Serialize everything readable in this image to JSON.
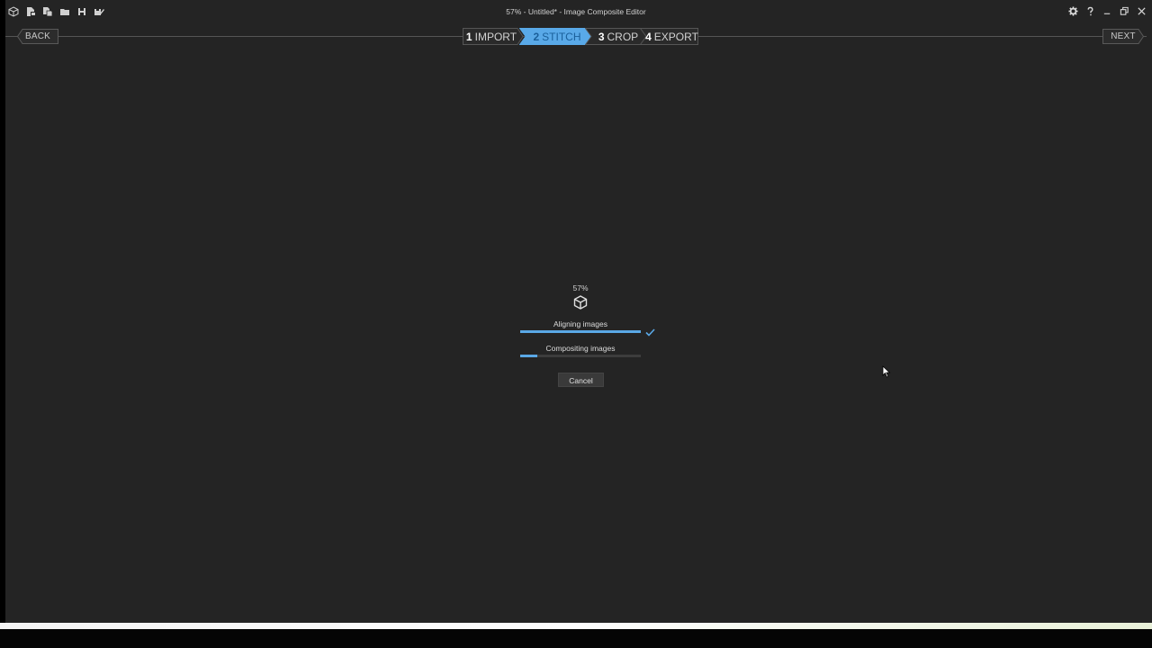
{
  "window": {
    "title": "57% - Untitled* - Image Composite Editor"
  },
  "quick_access_icons": [
    "app-cube-icon",
    "new-panorama-icon",
    "new-multi-icon",
    "open-folder-icon",
    "save-icon",
    "save-as-icon"
  ],
  "window_controls": [
    "settings-gear-icon",
    "help-icon",
    "minimize-icon",
    "restore-icon",
    "close-icon"
  ],
  "nav": {
    "back_label": "BACK",
    "next_label": "NEXT",
    "steps": [
      {
        "num": "1",
        "label": "IMPORT",
        "active": false
      },
      {
        "num": "2",
        "label": "STITCH",
        "active": true
      },
      {
        "num": "3",
        "label": "CROP",
        "active": false
      },
      {
        "num": "4",
        "label": "EXPORT",
        "active": false
      }
    ]
  },
  "progress": {
    "percent_text": "57%",
    "tasks": [
      {
        "label": "Aligning images",
        "progress": 1.0,
        "done": true
      },
      {
        "label": "Compositing images",
        "progress": 0.14,
        "done": false
      }
    ],
    "cancel_label": "Cancel"
  },
  "colors": {
    "background": "#242424",
    "accent": "#5aa8e6",
    "active_step": "#59a9e8"
  }
}
